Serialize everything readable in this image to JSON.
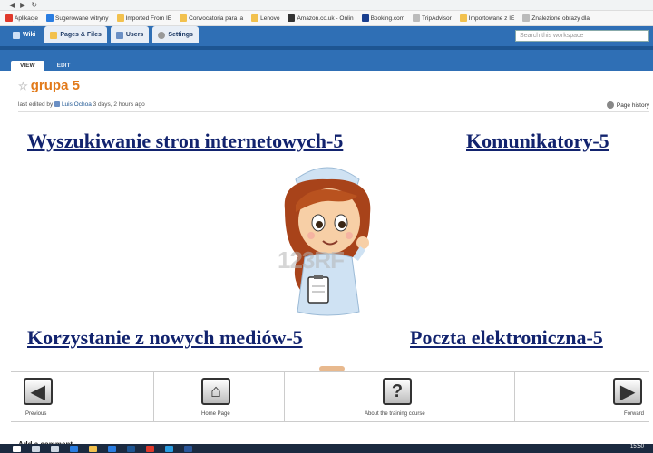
{
  "bookmarks": [
    {
      "label": "Aplikacje",
      "color": "#e0392b"
    },
    {
      "label": "Sugerowane witryny",
      "color": "#2a7de1"
    },
    {
      "label": "Imported From IE",
      "color": "#f2c14e"
    },
    {
      "label": "Convocatoria para la",
      "color": "#f2c14e"
    },
    {
      "label": "Lenovo",
      "color": "#f2c14e"
    },
    {
      "label": "Amazon.co.uk - Onlin",
      "color": "#333333"
    },
    {
      "label": "Booking.com",
      "color": "#1a3f8f"
    },
    {
      "label": "TripAdvisor",
      "color": "#bbbbbb"
    },
    {
      "label": "Importowane z IE",
      "color": "#f2c14e"
    },
    {
      "label": "Znalezione obrazy dla",
      "color": "#bbbbbb"
    }
  ],
  "navbar": {
    "wiki": "Wiki",
    "pages_files": "Pages & Files",
    "users": "Users",
    "settings": "Settings",
    "search_placeholder": "Search this workspace"
  },
  "view_tabs": {
    "view": "VIEW",
    "edit": "EDIT"
  },
  "page": {
    "title": "grupa 5",
    "meta_prefix": "last edited by",
    "author": "Luis Ochoa",
    "meta_time": "3 days, 2 hours ago",
    "history": "Page history"
  },
  "links": {
    "top_left": "Wyszukiwanie stron internetowych-5",
    "top_right": "Komunikatory-5",
    "bottom_left": "Korzystanie z nowych mediów-5",
    "bottom_right": "Poczta elektroniczna-5"
  },
  "watermark": "123RF",
  "bottom_nav": {
    "previous": "Previous",
    "home": "Home Page",
    "about": "About the training course",
    "forward": "Forward"
  },
  "add_comment": "Add a comment",
  "clock": "15:50",
  "colors": {
    "accent": "#2f6fb5",
    "title": "#e27a1a",
    "link": "#12236e"
  }
}
